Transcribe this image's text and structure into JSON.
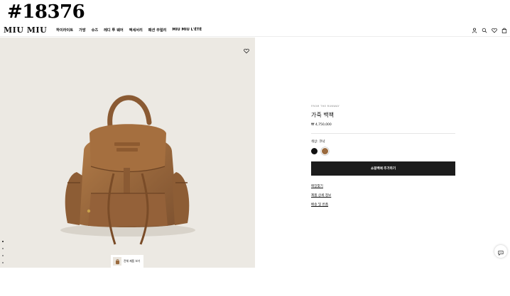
{
  "tag": "#18376",
  "header": {
    "logo": "MIU MIU",
    "nav": [
      "하이라이트",
      "가방",
      "슈즈",
      "레디 투 웨어",
      "액세서리",
      "패션 주얼리",
      "MIU MIU L'ÉTÉ"
    ],
    "icons": [
      "account-icon",
      "search-icon",
      "wishlist-icon",
      "bag-icon"
    ]
  },
  "product": {
    "eyebrow": "FROM THE RUNWAY",
    "title": "가죽 백팩",
    "price": "₩ 4,750,000",
    "color_label": "색상: 코냑",
    "swatches": [
      {
        "name": "black",
        "hex": "#111111"
      },
      {
        "name": "cognac",
        "hex": "#9a6a3e"
      }
    ],
    "add_to_cart": "쇼핑백에 추가하기",
    "links": [
      "매장찾기",
      "제품 상세 정보",
      "배송 및 반품"
    ]
  },
  "gallery": {
    "slide_count": 5,
    "active_index": 0,
    "thumb_label": "전체 제품 보기"
  },
  "colors": {
    "hero_bg": "#ece9e3",
    "leather": "#9a6a3e",
    "button_bg": "#1c1c1c"
  }
}
